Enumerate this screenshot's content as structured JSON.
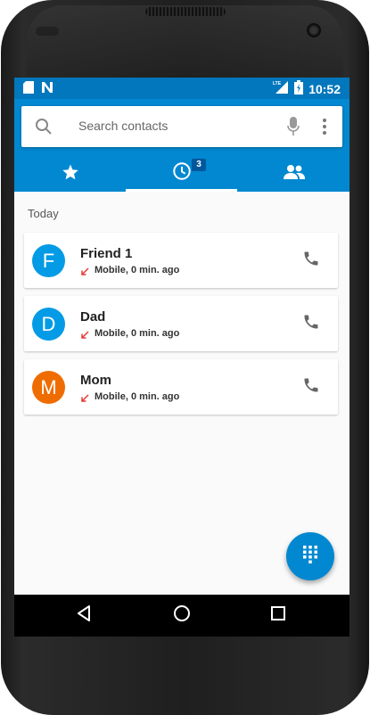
{
  "status_bar": {
    "time": "10:52",
    "left_icons": [
      "sd-card-icon",
      "n-notification-icon"
    ],
    "right_icons": [
      "lte-signal-icon",
      "battery-icon"
    ]
  },
  "search": {
    "placeholder": "Search contacts",
    "value": ""
  },
  "tabs": [
    {
      "name": "favorites",
      "icon": "star-icon",
      "selected": false
    },
    {
      "name": "recents",
      "icon": "clock-icon",
      "selected": true,
      "badge": "3"
    },
    {
      "name": "contacts",
      "icon": "people-icon",
      "selected": false
    }
  ],
  "section_header": "Today",
  "calls": [
    {
      "initial": "F",
      "name": "Friend 1",
      "details": "Mobile, 0 min. ago",
      "avatar_color": "#039be5",
      "call_type": "missed-call-icon"
    },
    {
      "initial": "D",
      "name": "Dad",
      "details": "Mobile, 0 min. ago",
      "avatar_color": "#039be5",
      "call_type": "missed-call-icon"
    },
    {
      "initial": "M",
      "name": "Mom",
      "details": "Mobile, 0 min. ago",
      "avatar_color": "#ef6c00",
      "call_type": "missed-call-icon"
    }
  ],
  "fab_icon": "dialpad-icon",
  "nav": [
    "back-icon",
    "home-icon",
    "recents-icon"
  ],
  "colors": {
    "primary": "#0288d1",
    "primary_dark": "#0277bd",
    "missed_call": "#e53935"
  }
}
